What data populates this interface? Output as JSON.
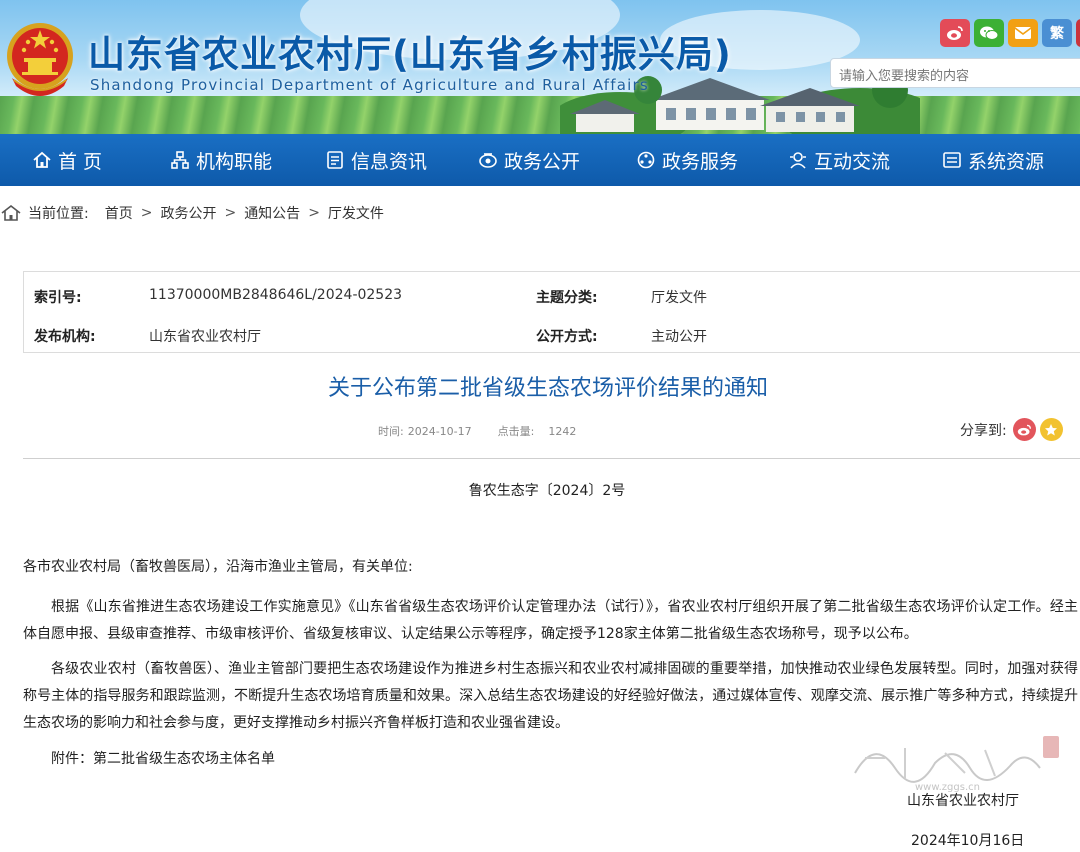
{
  "header": {
    "title": "山东省农业农村厅(山东省乡村振兴局)",
    "subtitle": "Shandong Provincial Department of Agriculture and Rural Affairs",
    "social": {
      "traditional_label": "繁"
    },
    "search": {
      "placeholder": "请输入您要搜索的内容"
    }
  },
  "nav": {
    "items": [
      {
        "label": "首 页",
        "icon": "home-icon"
      },
      {
        "label": "机构职能",
        "icon": "org-icon"
      },
      {
        "label": "信息资讯",
        "icon": "news-icon"
      },
      {
        "label": "政务公开",
        "icon": "open-gov-icon"
      },
      {
        "label": "政务服务",
        "icon": "service-icon"
      },
      {
        "label": "互动交流",
        "icon": "interaction-icon"
      },
      {
        "label": "系统资源",
        "icon": "resource-icon"
      }
    ]
  },
  "breadcrumb": {
    "prefix": "当前位置:",
    "items": [
      "首页",
      "政务公开",
      "通知公告",
      "厅发文件"
    ],
    "separator": ">"
  },
  "info": {
    "index_key": "索引号:",
    "index_val": "11370000MB2848646L/2024-02523",
    "topic_key": "主题分类:",
    "topic_val": "厅发文件",
    "publisher_key": "发布机构:",
    "publisher_val": "山东省农业农村厅",
    "open_key": "公开方式:",
    "open_val": "主动公开"
  },
  "article": {
    "title": "关于公布第二批省级生态农场评价结果的通知",
    "time_label": "时间:",
    "time": "2024-10-17",
    "clicks_label": "点击量:",
    "clicks": "1242",
    "share_label": "分享到:",
    "doc_number": "鲁农生态字〔2024〕2号",
    "salutation": "各市农业农村局（畜牧兽医局），沿海市渔业主管局，有关单位:",
    "para1": "根据《山东省推进生态农场建设工作实施意见》《山东省省级生态农场评价认定管理办法（试行）》，省农业农村厅组织开展了第二批省级生态农场评价认定工作。经主体自愿申报、县级审查推荐、市级审核评价、省级复核审议、认定结果公示等程序，确定授予128家主体第二批省级生态农场称号，现予以公布。",
    "para2": "各级农业农村（畜牧兽医）、渔业主管部门要把生态农场建设作为推进乡村生态振兴和农业农村减排固碳的重要举措，加快推动农业绿色发展转型。同时，加强对获得称号主体的指导服务和跟踪监测，不断提升生态农场培育质量和效果。深入总结生态农场建设的好经验好做法，通过媒体宣传、观摩交流、展示推广等多种方式，持续提升生态农场的影响力和社会参与度，更好支撑推动乡村振兴齐鲁样板打造和农业强省建设。",
    "attachment": "附件：第二批省级生态农场主体名单",
    "signature": "山东省农业农村厅",
    "date": "2024年10月16日"
  },
  "colors": {
    "nav_bg": "#1565b8",
    "title_blue": "#1a5ea8",
    "brand_blue": "#0a5aa8"
  }
}
